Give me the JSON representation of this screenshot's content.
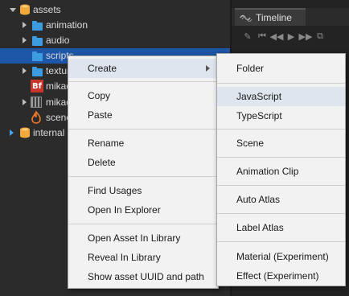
{
  "tree": {
    "items": [
      {
        "label": "assets"
      },
      {
        "label": "animation"
      },
      {
        "label": "audio"
      },
      {
        "label": "scripts"
      },
      {
        "label": "textures"
      },
      {
        "label": "mikado"
      },
      {
        "label": "mikado"
      },
      {
        "label": "scene"
      },
      {
        "label": "internal"
      }
    ]
  },
  "timeline": {
    "tab_label": "Timeline"
  },
  "context_menu": {
    "items": [
      {
        "label": "Create"
      },
      {
        "label": "Copy"
      },
      {
        "label": "Paste"
      },
      {
        "label": "Rename"
      },
      {
        "label": "Delete"
      },
      {
        "label": "Find Usages"
      },
      {
        "label": "Open In Explorer"
      },
      {
        "label": "Open Asset In Library"
      },
      {
        "label": "Reveal In Library"
      },
      {
        "label": "Show asset UUID and path"
      }
    ]
  },
  "create_submenu": {
    "items": [
      {
        "label": "Folder"
      },
      {
        "label": "JavaScript"
      },
      {
        "label": "TypeScript"
      },
      {
        "label": "Scene"
      },
      {
        "label": "Animation Clip"
      },
      {
        "label": "Auto Atlas"
      },
      {
        "label": "Label Atlas"
      },
      {
        "label": "Material (Experiment)"
      },
      {
        "label": "Effect (Experiment)"
      }
    ]
  },
  "colors": {
    "selection": "#1e56a8",
    "folder": "#3d9be0",
    "db_icon": "#f2a93b",
    "menu_bg": "#f2f2f2",
    "menu_highlight": "#dfe5ee"
  }
}
